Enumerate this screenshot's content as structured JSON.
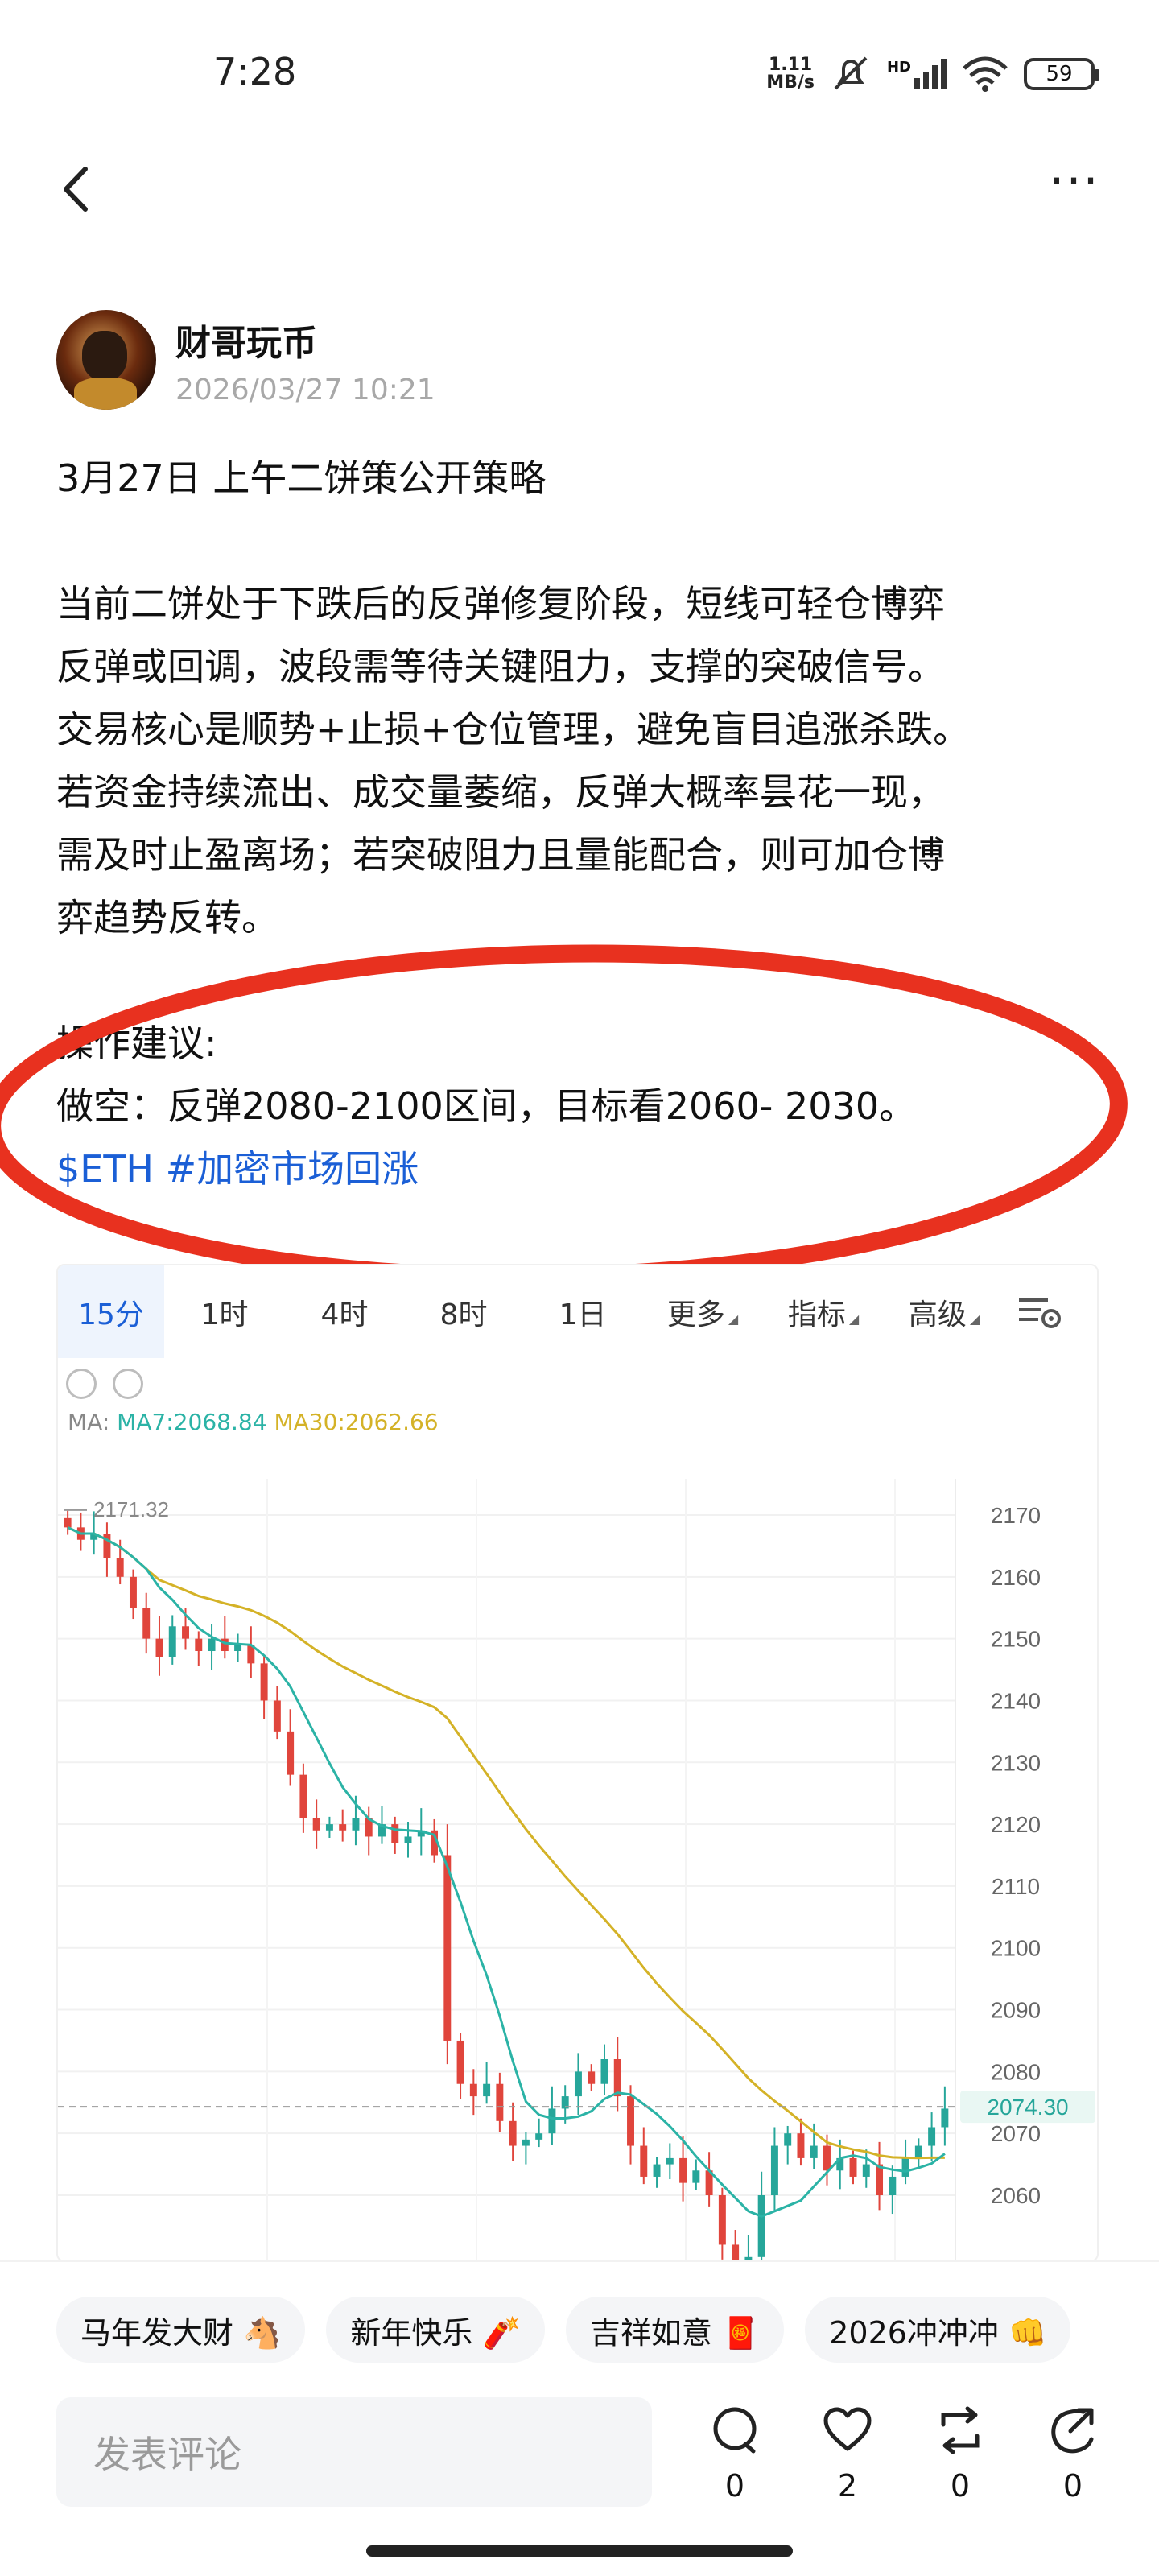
{
  "status_bar": {
    "time": "7:28",
    "net_speed_value": "1.11",
    "net_speed_unit": "MB/s",
    "network_label": "HD",
    "battery": "59"
  },
  "author": {
    "name": "财哥玩币",
    "post_time": "2026/03/27 10:21"
  },
  "post": {
    "title": "3月27日 上午二饼策公开策略",
    "paragraph_lines": [
      "当前二饼处于下跌后的反弹修复阶段，短线可轻仓博弈",
      "反弹或回调，波段需等待关键阻力，支撑的突破信号。",
      "交易核心是顺势+止损+仓位管理，避免盲目追涨杀跌。",
      "若资金持续流出、成交量萎缩，反弹大概率昙花一现，",
      "需及时止盈离场；若突破阻力且量能配合，则可加仓博",
      "弈趋势反转。"
    ],
    "advice_heading": "操作建议:",
    "advice_line": "做空：反弹2080-2100区间，目标看2060- 2030。",
    "tags": "$ETH #加密市场回涨",
    "annotation_color": "#e8311f"
  },
  "chart": {
    "tabs": [
      "15分",
      "1时",
      "4时",
      "8时",
      "1日",
      "更多",
      "指标",
      "高级"
    ],
    "active_tab": "15分",
    "ma_label": "MA:",
    "ma7": "MA7:2068.84",
    "ma30": "MA30:2062.66",
    "high_label": "2171.32",
    "price_labels": [
      "2170",
      "2160",
      "2150",
      "2140",
      "2130",
      "2120",
      "2110",
      "2100",
      "2090",
      "2080",
      "2070",
      "2060"
    ],
    "current_price": "2074.30",
    "colors": {
      "up": "#26a69a",
      "down": "#e0453c",
      "ma7": "#2bb3a6",
      "ma30": "#d4b227"
    }
  },
  "chart_data": {
    "type": "candlestick",
    "interval": "15分",
    "ylim": [
      2055,
      2175
    ],
    "y_ticks": [
      2170,
      2160,
      2150,
      2140,
      2130,
      2120,
      2110,
      2100,
      2090,
      2080,
      2070,
      2060
    ],
    "current_price": 2074.3,
    "period_high": 2171.32,
    "ma7_last": 2068.84,
    "ma30_last": 2062.66,
    "close_path": [
      2168,
      2166,
      2167,
      2163,
      2160,
      2155,
      2150,
      2147,
      2152,
      2150,
      2148,
      2150,
      2148,
      2149,
      2146,
      2140,
      2135,
      2128,
      2121,
      2119,
      2120,
      2119,
      2121,
      2118,
      2120,
      2117,
      2118,
      2119,
      2115,
      2085,
      2078,
      2076,
      2078,
      2072,
      2068,
      2069,
      2070,
      2074,
      2076,
      2080,
      2078,
      2082,
      2076,
      2068,
      2063,
      2065,
      2066,
      2062,
      2064,
      2060,
      2052,
      2048,
      2050,
      2060,
      2068,
      2070,
      2066,
      2068,
      2064,
      2066,
      2063,
      2065,
      2060,
      2063,
      2066,
      2068,
      2071,
      2074
    ]
  },
  "emoji_chips": [
    "马年发大财 🐴",
    "新年快乐 🧨",
    "吉祥如意 🧧",
    "2026冲冲冲 👊"
  ],
  "bottom_bar": {
    "comment_placeholder": "发表评论",
    "comment_count": "0",
    "like_count": "2",
    "repost_count": "0",
    "share_count": "0"
  }
}
